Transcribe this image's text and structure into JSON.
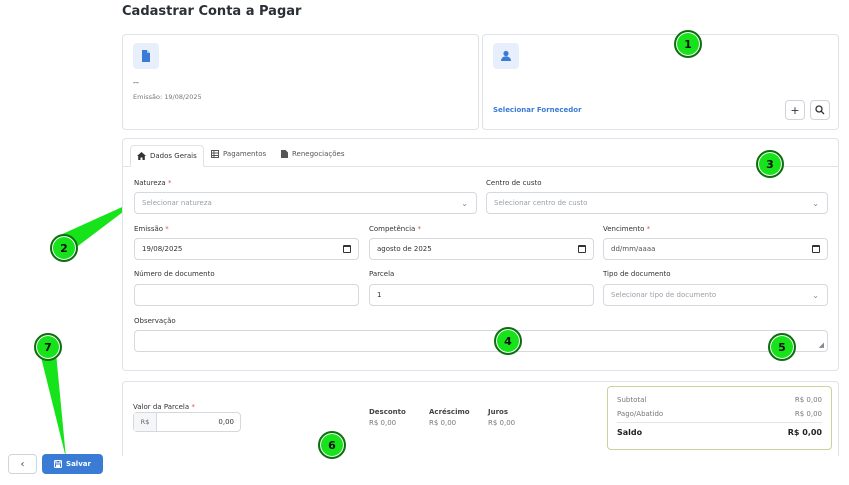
{
  "page": {
    "title": "Cadastrar Conta a Pagar"
  },
  "document_card": {
    "value": "--",
    "emission": "Emissão: 19/08/2025"
  },
  "supplier_card": {
    "select_label": "Selecionar Fornecedor",
    "add_symbol": "+",
    "search_symbol": "⌕"
  },
  "tabs": [
    {
      "label": "Dados Gerais",
      "icon": "home-icon"
    },
    {
      "label": "Pagamentos",
      "icon": "table-icon"
    },
    {
      "label": "Renegociações",
      "icon": "document-icon"
    }
  ],
  "form": {
    "natureza": {
      "label": "Natureza",
      "required": "*",
      "placeholder": "Selecionar natureza"
    },
    "centro": {
      "label": "Centro de custo",
      "placeholder": "Selecionar centro de custo"
    },
    "emissao": {
      "label": "Emissão",
      "required": "*",
      "value": "19/08/2025"
    },
    "competencia": {
      "label": "Competência",
      "required": "*",
      "value": "agosto de 2025"
    },
    "vencimento": {
      "label": "Vencimento",
      "required": "*",
      "placeholder": "dd/mm/aaaa"
    },
    "numero_doc": {
      "label": "Número de documento",
      "value": ""
    },
    "parcela": {
      "label": "Parcela",
      "value": "1"
    },
    "tipo_doc": {
      "label": "Tipo de documento",
      "placeholder": "Selecionar tipo de documento"
    },
    "observacao": {
      "label": "Observação",
      "value": ""
    }
  },
  "valores": {
    "valor_parcela_label": "Valor da Parcela",
    "required": "*",
    "currency": "R$",
    "valor_parcela": "0,00",
    "desconto": {
      "label": "Desconto",
      "value": "R$ 0,00"
    },
    "acrescimo": {
      "label": "Acréscimo",
      "value": "R$ 0,00"
    },
    "juros": {
      "label": "Juros",
      "value": "R$ 0,00"
    }
  },
  "summary": {
    "subtotal_label": "Subtotal",
    "subtotal": "R$ 0,00",
    "pago_label": "Pago/Abatido",
    "pago": "R$ 0,00",
    "saldo_label": "Saldo",
    "saldo": "R$ 0,00"
  },
  "footer": {
    "back_symbol": "‹",
    "save_label": "Salvar"
  },
  "markers": [
    "1",
    "2",
    "3",
    "4",
    "5",
    "6",
    "7"
  ],
  "colors": {
    "accent": "#3a7bd5",
    "marker_green": "#16e31a",
    "summary_border": "#c9d39a"
  }
}
